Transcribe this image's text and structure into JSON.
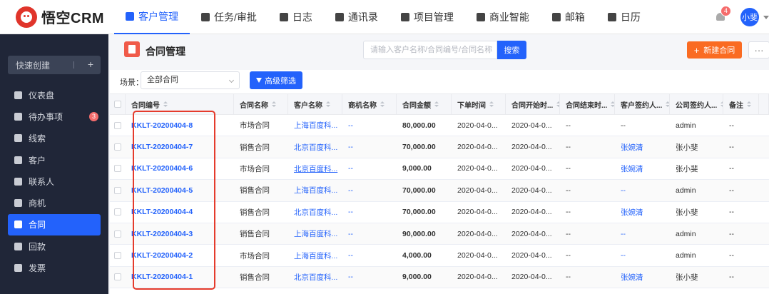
{
  "topbar": {
    "logo_text": "悟空CRM",
    "nav": [
      {
        "label": "客户管理",
        "icon": "bar-chart-icon",
        "active": true
      },
      {
        "label": "任务/审批",
        "icon": "briefcase-icon"
      },
      {
        "label": "日志",
        "icon": "document-icon"
      },
      {
        "label": "通讯录",
        "icon": "contact-book-icon"
      },
      {
        "label": "项目管理",
        "icon": "list-icon"
      },
      {
        "label": "商业智能",
        "icon": "shield-icon"
      },
      {
        "label": "邮箱",
        "icon": "mail-icon"
      },
      {
        "label": "日历",
        "icon": "calendar-icon"
      }
    ],
    "notification_count": "4",
    "user_name": "小斐"
  },
  "sidebar": {
    "quick_create": "快速创建",
    "items": [
      {
        "label": "仪表盘",
        "icon": "dashboard-icon"
      },
      {
        "label": "待办事项",
        "icon": "chat-icon",
        "badge": "3"
      },
      {
        "label": "线索",
        "icon": "leads-icon"
      },
      {
        "label": "客户",
        "icon": "customer-icon"
      },
      {
        "label": "联系人",
        "icon": "contact-icon"
      },
      {
        "label": "商机",
        "icon": "opportunity-icon"
      },
      {
        "label": "合同",
        "icon": "contract-icon",
        "active": true
      },
      {
        "label": "回款",
        "icon": "payment-icon"
      },
      {
        "label": "发票",
        "icon": "invoice-icon"
      }
    ]
  },
  "page": {
    "title": "合同管理",
    "search_placeholder": "请输入客户名称/合同编号/合同名称",
    "search_button": "搜索",
    "new_button": "新建合同",
    "more_button": "···",
    "scene_label": "场景：",
    "scene_value": "全部合同",
    "filter_button": "高级筛选"
  },
  "table": {
    "columns": [
      "合同编号",
      "合同名称",
      "客户名称",
      "商机名称",
      "合同金额",
      "下单时间",
      "合同开始时...",
      "合同结束时...",
      "客户签约人...",
      "公司签约人...",
      "备注"
    ],
    "rows": [
      {
        "code": "KKLT-20200404-8",
        "name": "市场合同",
        "customer": "上海百度科...",
        "opportunity": "--",
        "amount": "80,000.00",
        "order_date": "2020-04-0...",
        "start_date": "2020-04-0...",
        "end_date": "--",
        "customer_signer": "--",
        "company_signer": "admin",
        "remark": "--"
      },
      {
        "code": "KKLT-20200404-7",
        "name": "销售合同",
        "customer": "北京百度科...",
        "opportunity": "--",
        "amount": "70,000.00",
        "order_date": "2020-04-0...",
        "start_date": "2020-04-0...",
        "end_date": "--",
        "customer_signer": "张婉清",
        "company_signer": "张小斐",
        "remark": "--"
      },
      {
        "code": "KKLT-20200404-6",
        "name": "市场合同",
        "customer": "北京百度科...",
        "opportunity": "--",
        "amount": "9,000.00",
        "order_date": "2020-04-0...",
        "start_date": "2020-04-0...",
        "end_date": "--",
        "customer_signer": "张婉清",
        "company_signer": "张小斐",
        "remark": "--"
      },
      {
        "code": "KKLT-20200404-5",
        "name": "销售合同",
        "customer": "上海百度科...",
        "opportunity": "--",
        "amount": "70,000.00",
        "order_date": "2020-04-0...",
        "start_date": "2020-04-0...",
        "end_date": "--",
        "customer_signer": "--",
        "company_signer": "admin",
        "remark": "--"
      },
      {
        "code": "KKLT-20200404-4",
        "name": "销售合同",
        "customer": "北京百度科...",
        "opportunity": "--",
        "amount": "70,000.00",
        "order_date": "2020-04-0...",
        "start_date": "2020-04-0...",
        "end_date": "--",
        "customer_signer": "张婉清",
        "company_signer": "张小斐",
        "remark": "--"
      },
      {
        "code": "KKLT-20200404-3",
        "name": "销售合同",
        "customer": "上海百度科...",
        "opportunity": "--",
        "amount": "90,000.00",
        "order_date": "2020-04-0...",
        "start_date": "2020-04-0...",
        "end_date": "--",
        "customer_signer": "--",
        "company_signer": "admin",
        "remark": "--"
      },
      {
        "code": "KKLT-20200404-2",
        "name": "市场合同",
        "customer": "上海百度科...",
        "opportunity": "--",
        "amount": "4,000.00",
        "order_date": "2020-04-0...",
        "start_date": "2020-04-0...",
        "end_date": "--",
        "customer_signer": "--",
        "company_signer": "admin",
        "remark": "--"
      },
      {
        "code": "KKLT-20200404-1",
        "name": "销售合同",
        "customer": "北京百度科...",
        "opportunity": "--",
        "amount": "9,000.00",
        "order_date": "2020-04-0...",
        "start_date": "2020-04-0...",
        "end_date": "--",
        "customer_signer": "张婉清",
        "company_signer": "张小斐",
        "remark": "--"
      }
    ]
  },
  "colors": {
    "primary": "#2362fb",
    "sidebar_bg": "#202638",
    "new_button": "#fa6b22",
    "highlight_box": "#e53b2c",
    "badge": "#f56c6c"
  }
}
